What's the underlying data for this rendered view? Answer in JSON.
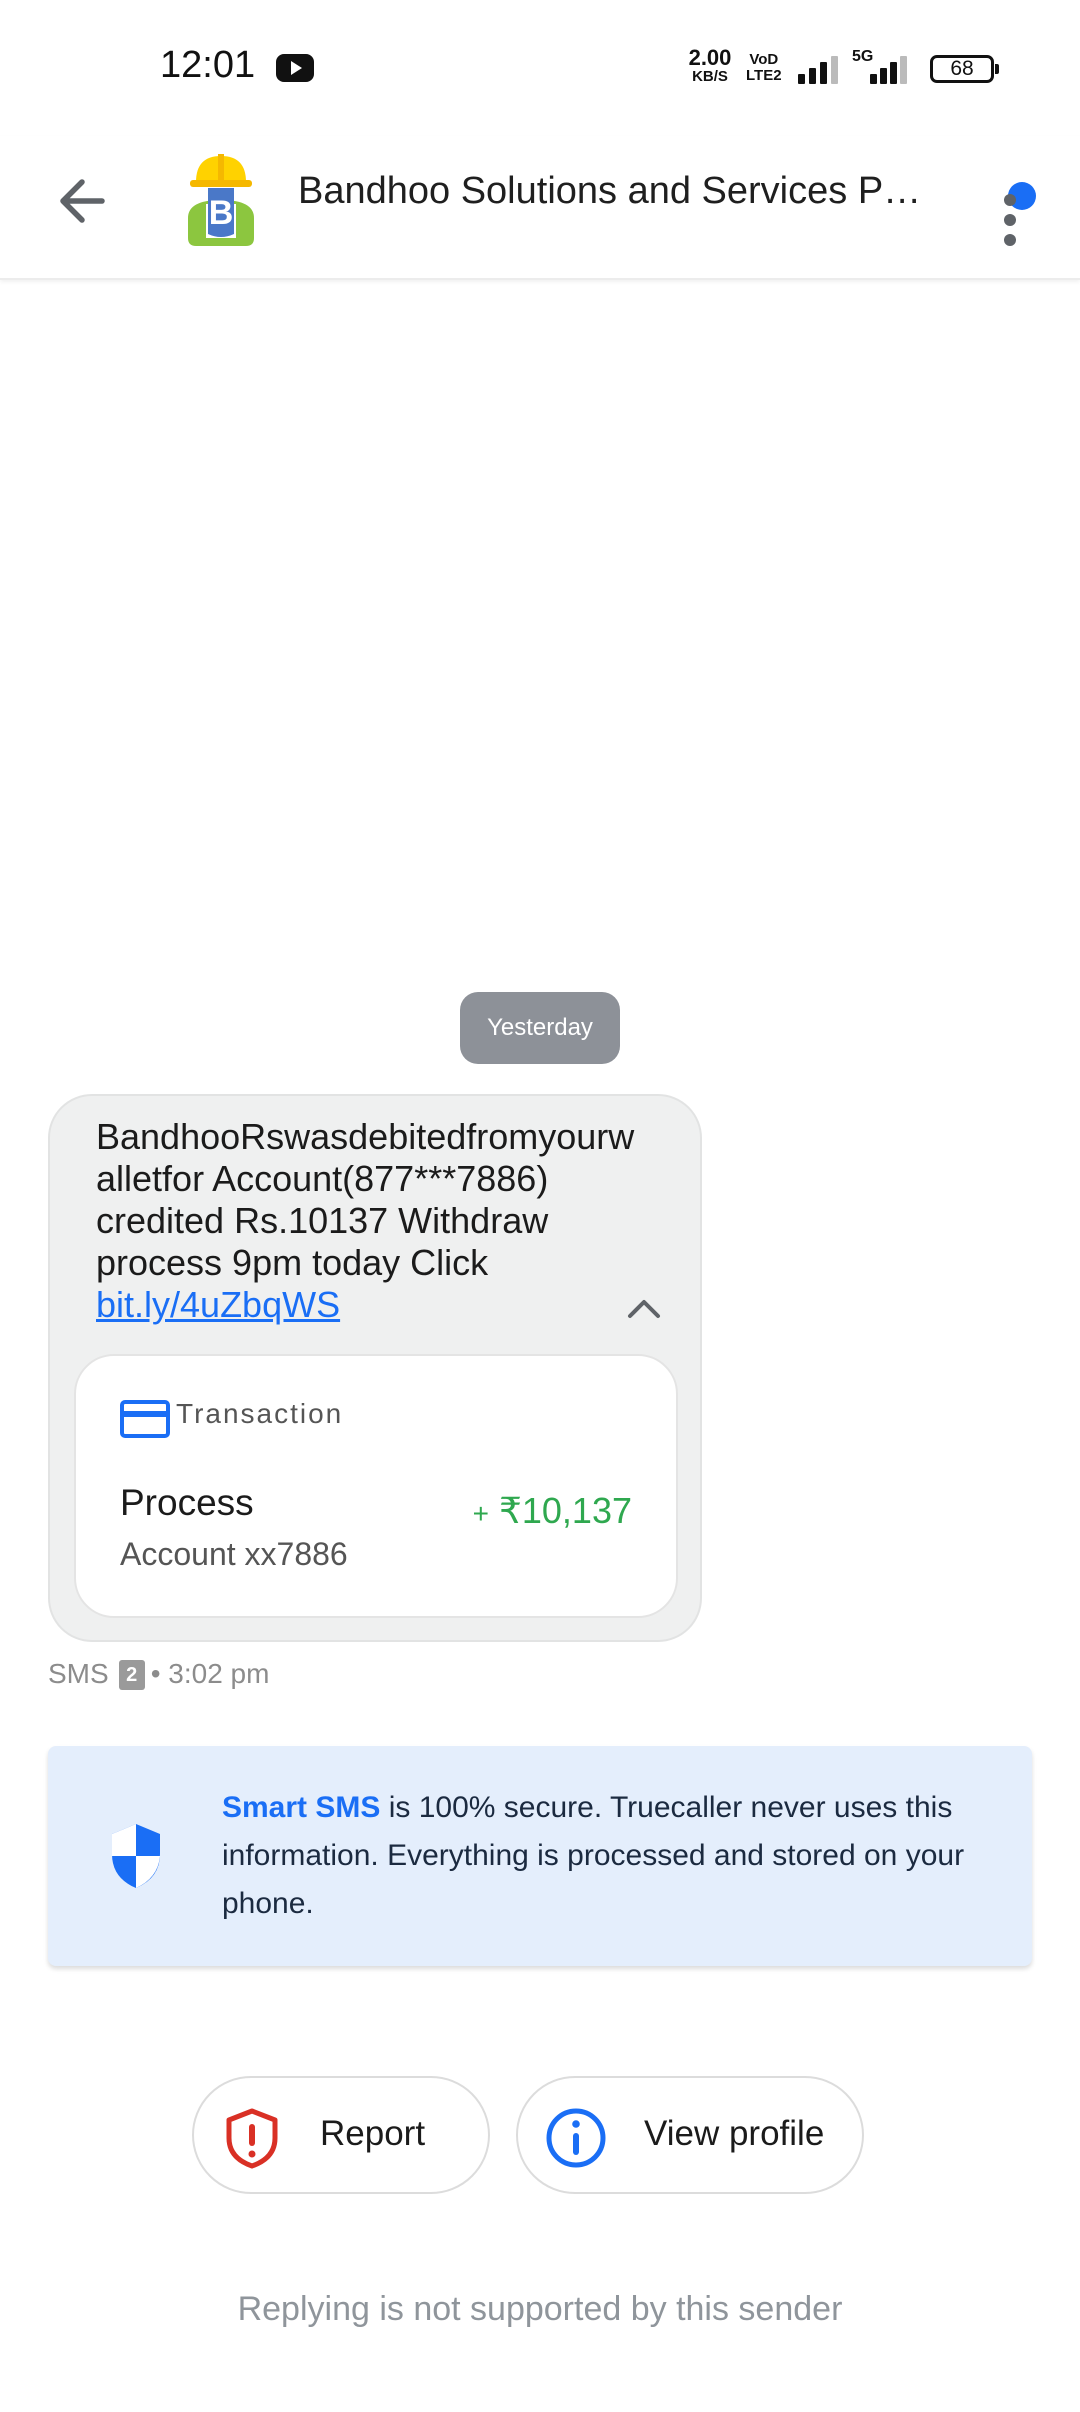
{
  "status_bar": {
    "time": "12:01",
    "net_speed_value": "2.00",
    "net_speed_unit": "KB/S",
    "volte_line1": "VoD",
    "volte_line2": "LTE2",
    "network_type": "5G",
    "battery": "68"
  },
  "app_bar": {
    "contact_name": "Bandhoo Solutions and Services Pvt. Ltd."
  },
  "conversation": {
    "date_chip": "Yesterday",
    "message": {
      "text": "BandhooRswasdebitedfromyourwalletfor Account(877***7886) credited Rs.10137 Withdraw process  9pm today Click",
      "link": "bit.ly/4uZbqWS",
      "transaction": {
        "label": "Transaction",
        "title": "Process",
        "subtitle": "Account xx7886",
        "amount_sign": "+",
        "amount": "₹10,137"
      },
      "meta_type": "SMS",
      "sim": "2",
      "time": "• 3:02 pm"
    }
  },
  "smart_sms": {
    "brand": "Smart SMS",
    "text": " is 100% secure. Truecaller never uses this information. Everything is processed and stored on your phone."
  },
  "actions": {
    "report_label": "Report",
    "view_profile_label": "View profile"
  },
  "footer": {
    "reply_note": "Replying is not supported by this sender"
  },
  "colors": {
    "accent": "#1a6ef5",
    "amount_green": "#2fa84f",
    "report_red": "#d93025",
    "bubble_bg": "#eff0f0",
    "banner_bg": "#e4eefc"
  }
}
